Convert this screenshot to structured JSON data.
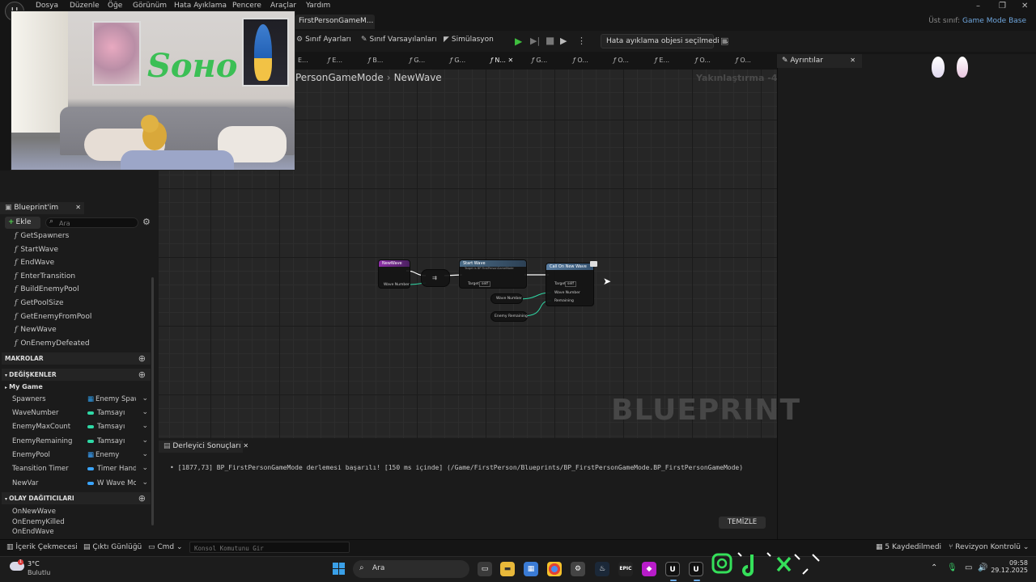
{
  "menu": {
    "items": [
      "Dosya",
      "Düzenle",
      "Öğe",
      "Görünüm",
      "Hata Ayıklama",
      "Pencere",
      "Araçlar",
      "Yardım"
    ],
    "window_controls": [
      "–",
      "❐",
      "✕"
    ]
  },
  "document_tab": {
    "label": "FirstPersonGameM...",
    "modified": "•",
    "close": "✕"
  },
  "parent_class": {
    "label": "Üst sınıf:",
    "value": "Game Mode Base"
  },
  "toolbar": {
    "class_settings": "Sınıf Ayarları",
    "class_defaults": "Sınıf Varsayılanları",
    "simulation": "Simülasyon",
    "debug_object": "Hata ayıklama objesi seçilmedi"
  },
  "function_tabs": [
    {
      "label": "E...",
      "kind": "event"
    },
    {
      "label": "E...",
      "kind": "fn"
    },
    {
      "label": "B...",
      "kind": "fn"
    },
    {
      "label": "G...",
      "kind": "fn"
    },
    {
      "label": "G...",
      "kind": "fn"
    },
    {
      "label": "N...",
      "kind": "fn",
      "active": true
    },
    {
      "label": "G...",
      "kind": "fn"
    },
    {
      "label": "O...",
      "kind": "fn"
    },
    {
      "label": "O...",
      "kind": "fn"
    },
    {
      "label": "E...",
      "kind": "fn"
    },
    {
      "label": "O...",
      "kind": "fn"
    },
    {
      "label": "O...",
      "kind": "fn"
    }
  ],
  "details_tab": {
    "label": "Ayrıntılar"
  },
  "breadcrumb": {
    "parent": "PersonGameMode",
    "current": "NewWave"
  },
  "zoom_label": "Yakınlaştırma -4",
  "graph_watermark": "BLUEPRINT",
  "nodes": {
    "entry": {
      "title": "NewWave",
      "pin": "Wave Number"
    },
    "start_wave": {
      "title": "Start Wave",
      "subtitle": "Target is BP FirstPersonGameMode",
      "target_label": "Target",
      "target_value": "self"
    },
    "call_new_wave": {
      "title": "Call On New Wave",
      "target_label": "Target",
      "target_value": "self",
      "pins": [
        "Wave Number",
        "Remaining"
      ]
    },
    "get_wave_number": {
      "label": "Wave Number"
    },
    "get_enemy_remaining": {
      "label": "Enemy Remaining"
    }
  },
  "blueprint_panel": {
    "tab": "Blueprint'im",
    "add_label": "Ekle",
    "search_placeholder": "Ara",
    "functions": [
      "GetSpawners",
      "StartWave",
      "EndWave",
      "EnterTransition",
      "BuildEnemyPool",
      "GetPoolSize",
      "GetEnemyFromPool",
      "NewWave",
      "OnEnemyDefeated"
    ],
    "macros_header": "MAKROLAR",
    "variables_header": "DEĞİŞKENLER",
    "category": "My Game",
    "variables": [
      {
        "name": "Spawners",
        "type": "Enemy Spaw",
        "color": "#2e9be6",
        "grid": true
      },
      {
        "name": "WaveNumber",
        "type": "Tamsayı",
        "color": "#2fd9a6"
      },
      {
        "name": "EnemyMaxCount",
        "type": "Tamsayı",
        "color": "#2fd9a6"
      },
      {
        "name": "EnemyRemaining",
        "type": "Tamsayı",
        "color": "#2fd9a6"
      },
      {
        "name": "EnemyPool",
        "type": "Enemy",
        "color": "#3aa5ff",
        "grid": true
      },
      {
        "name": "Teansition Timer",
        "type": "Timer Hand",
        "color": "#3aa5ff"
      },
      {
        "name": "NewVar",
        "type": "W Wave Mo",
        "color": "#3aa5ff"
      }
    ],
    "dispatchers_header": "OLAY DAĞITICILARI",
    "dispatchers": [
      "OnNewWave",
      "OnEnemyKilled",
      "OnEndWave"
    ]
  },
  "compiler": {
    "tab": "Derleyici Sonuçları",
    "message": "[1877,73] BP_FirstPersonGameMode derlemesi başarılı! [150 ms içinde] (/Game/FirstPerson/Blueprints/BP_FirstPersonGameMode.BP_FirstPersonGameMode)",
    "clear": "TEMİZLE"
  },
  "statusbar": {
    "content_drawer": "İçerik Çekmecesi",
    "output_log": "Çıktı Günlüğü",
    "cmd": "Cmd",
    "console_placeholder": "Konsol Komutunu Gir",
    "unsaved": "5 Kaydedilmedi",
    "revision": "Revizyon Kontrolü"
  },
  "taskbar": {
    "weather_temp": "3°C",
    "weather_cond": "Bulutlu",
    "weather_badge": "1",
    "search_label": "Ara",
    "time": "09:58",
    "date": "29.12.2025"
  },
  "webcam_overlay_text": "Sонo"
}
